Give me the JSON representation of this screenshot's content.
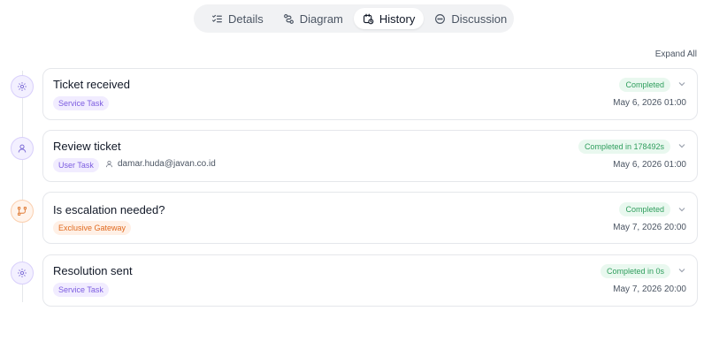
{
  "tabs": [
    {
      "label": "Details",
      "icon": "list-check-icon",
      "active": false
    },
    {
      "label": "Diagram",
      "icon": "diagram-icon",
      "active": false
    },
    {
      "label": "History",
      "icon": "history-icon",
      "active": true
    },
    {
      "label": "Discussion",
      "icon": "chat-icon",
      "active": false
    }
  ],
  "expand_all_label": "Expand All",
  "events": [
    {
      "title": "Ticket received",
      "tag": "Service Task",
      "status": "Completed",
      "timestamp": "May 6, 2026 01:00",
      "icon": "gear-icon"
    },
    {
      "title": "Review ticket",
      "tag": "User Task",
      "assignee": "damar.huda@javan.co.id",
      "status": "Completed in 178492s",
      "timestamp": "May 6, 2026 01:00",
      "icon": "user-icon"
    },
    {
      "title": "Is escalation needed?",
      "tag": "Exclusive Gateway",
      "status": "Completed",
      "timestamp": "May 7, 2026 20:00",
      "icon": "gateway-icon"
    },
    {
      "title": "Resolution sent",
      "tag": "Service Task",
      "status": "Completed in 0s",
      "timestamp": "May 7, 2026 20:00",
      "icon": "gear-icon"
    }
  ],
  "colors": {
    "status_bg": "#e9f8ef",
    "status_text": "#2f9e5d",
    "task_tag_bg": "#f1ecff",
    "task_tag_text": "#7c5ce0",
    "gateway_tag_bg": "#fff0e6",
    "gateway_tag_text": "#e06a1f"
  }
}
